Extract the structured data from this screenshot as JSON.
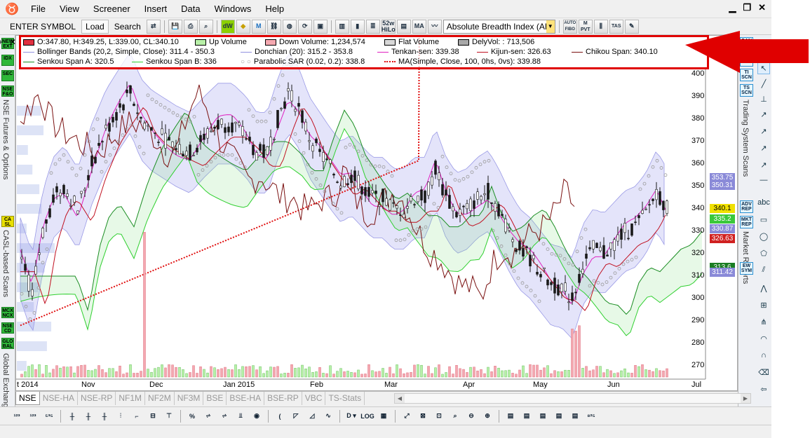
{
  "menu": [
    "File",
    "View",
    "Screener",
    "Insert",
    "Data",
    "Windows",
    "Help"
  ],
  "toolbar": {
    "enter_symbol": "ENTER SYMBOL",
    "load": "Load",
    "search": "Search",
    "indicator_selected": "Absolute Breadth Index (ABI",
    "btn_52w": "52w HiLo",
    "btn_auto_fibo": "AUTO FIBO",
    "btn_m_pvt": "M PVT",
    "btn_tas": "TAS"
  },
  "legend": {
    "ohlc": "O:347.80, H:349.25, L:339.00, CL:340.10",
    "up_volume": "Up Volume",
    "down_volume": "Down Volume: 1,234,574",
    "flat_volume": "Flat Volume",
    "dely_vol": "DelyVol: : 713,506",
    "bollinger": "Bollinger Bands (20,2, Simple, Close): 311.4 - 350.3",
    "donchian": "Donchian (20): 315.2 - 353.8",
    "tenkan": "Tenkan-sen: 339.38",
    "kijun": "Kijun-sen: 326.63",
    "chikou": "Chikou Span: 340.10",
    "senkou_a": "Senkou Span A: 320.5",
    "senkou_b": "Senkou Span B: 336",
    "psar": "Parabolic SAR (0.02, 0.2): 338.8",
    "ma": "MA(Simple, Close, 100, 0hs, 0vs): 339.88",
    "controls": "e − + ✕"
  },
  "left_sidebar": {
    "icons": [
      "NEW EXT",
      "IDX",
      "SEC",
      "NSE F&O",
      "CA SL",
      "MCX NCX",
      "NSE CD",
      "GLO BAL"
    ],
    "tabs": [
      "NSE Futures & Options",
      "CASL-based Scans",
      "Global Exchang"
    ]
  },
  "right_sidebar": {
    "icons": [
      "CAN SCN",
      "SCN",
      "TI SCN",
      "TS SCN",
      "ADV REP",
      "MKT REP",
      "EW SYM"
    ],
    "tabs": [
      "Trading System Scans",
      "Market Reports"
    ],
    "tool_abc": "abc"
  },
  "y_axis": [
    "400",
    "390",
    "380",
    "370",
    "360",
    "350",
    "340",
    "330",
    "320",
    "310",
    "300",
    "290",
    "280",
    "270"
  ],
  "price_boxes": [
    {
      "label": "353.75",
      "color": "#8a8ad8"
    },
    {
      "label": "350.31",
      "color": "#8a8ad8"
    },
    {
      "label": "340.1",
      "color": "#f0e000"
    },
    {
      "label": "335.2",
      "color": "#3ac83a"
    },
    {
      "label": "330.87",
      "color": "#8a8ad8"
    },
    {
      "label": "326.63",
      "color": "#d02020"
    },
    {
      "label": "313.6",
      "color": "#1a7d22"
    },
    {
      "label": "311.42",
      "color": "#8a8ad8"
    }
  ],
  "x_axis": [
    "t 2014",
    "Nov",
    "Dec",
    "Jan 2015",
    "Feb",
    "Mar",
    "Apr",
    "May",
    "Jun",
    "Jul"
  ],
  "tabs": [
    "NSE",
    "NSE-HA",
    "NSE-RP",
    "NF1M",
    "NF2M",
    "NF3M",
    "BSE",
    "BSE-HA",
    "BSE-RP",
    "VBC",
    "TS-Stats"
  ],
  "active_tab": "NSE",
  "colors": {
    "accent_red": "#e00000",
    "candle_body": "#1a1a1a",
    "bollinger": "#7070e0",
    "tenkan": "#e020c0",
    "kijun": "#c01020",
    "chikou": "#7a1010",
    "ma": "#e01010",
    "senkou_a": "#1a8d22",
    "senkou_b": "#30d030"
  }
}
